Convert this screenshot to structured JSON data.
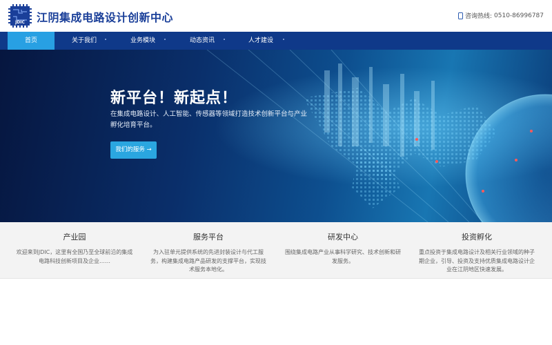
{
  "brand": {
    "logo_text": "JDIC",
    "title": "江阴集成电路设计创新中心"
  },
  "hotline": {
    "icon": "phone-icon",
    "label": "咨询热线:",
    "number": "0510-86996787"
  },
  "nav": {
    "items": [
      {
        "label": "首页",
        "active": true
      },
      {
        "label": "关于我们",
        "active": false
      },
      {
        "label": "业务模块",
        "active": false
      },
      {
        "label": "动态资讯",
        "active": false
      },
      {
        "label": "人才建设",
        "active": false
      }
    ]
  },
  "hero": {
    "title": "新平台！新起点！",
    "description": "在集成电路设计、人工智能、传感器等领域打造技术创新平台与产业孵化培育平台。",
    "button_label": "我们的服务 →"
  },
  "features": [
    {
      "title": "产业园",
      "description": "欢迎来到JDIC，这里有全国乃至全球前沿的集成电路科技创新项目及企业……"
    },
    {
      "title": "服务平台",
      "description": "为入驻单元提供系统的先进封装设计与代工服务，构建集成电路产品研发的支撑平台，实现技术服务本地化。"
    },
    {
      "title": "研发中心",
      "description": "围绕集成电路产业从事科学研究、技术创新和研发服务。"
    },
    {
      "title": "投资孵化",
      "description": "重点投资于集成电路设计及相关行业领域的种子期企业，引导、投资及支持优质集成电路设计企业在江阴地区快速发展。"
    }
  ],
  "colors": {
    "nav_bg": "#0f3989",
    "nav_active": "#28a0e3",
    "brand": "#1a3f99",
    "button": "#2aa6e0"
  }
}
